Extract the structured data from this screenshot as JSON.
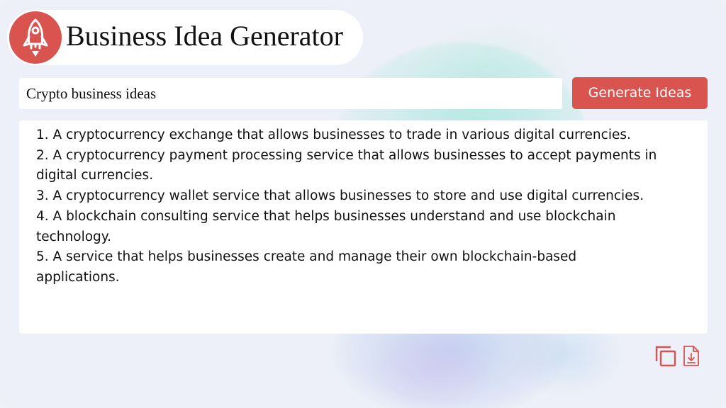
{
  "app": {
    "title": "Business Idea Generator",
    "logo_icon": "rocket-icon"
  },
  "search": {
    "value": "Crypto business ideas",
    "placeholder": ""
  },
  "actions": {
    "generate_label": "Generate Ideas",
    "copy_icon": "copy-icon",
    "download_icon": "download-file-icon"
  },
  "results": [
    "1. A cryptocurrency exchange that allows businesses to trade in various digital currencies.",
    "2. A cryptocurrency payment processing service that allows businesses to accept payments in digital currencies.",
    "3. A cryptocurrency wallet service that allows businesses to store and use digital currencies.",
    "4. A blockchain consulting service that helps businesses understand and use blockchain technology.",
    "5. A service that helps businesses create and manage their own blockchain-based applications."
  ],
  "colors": {
    "accent": "#d9534f",
    "background": "#edf0f8",
    "card": "#ffffff"
  }
}
